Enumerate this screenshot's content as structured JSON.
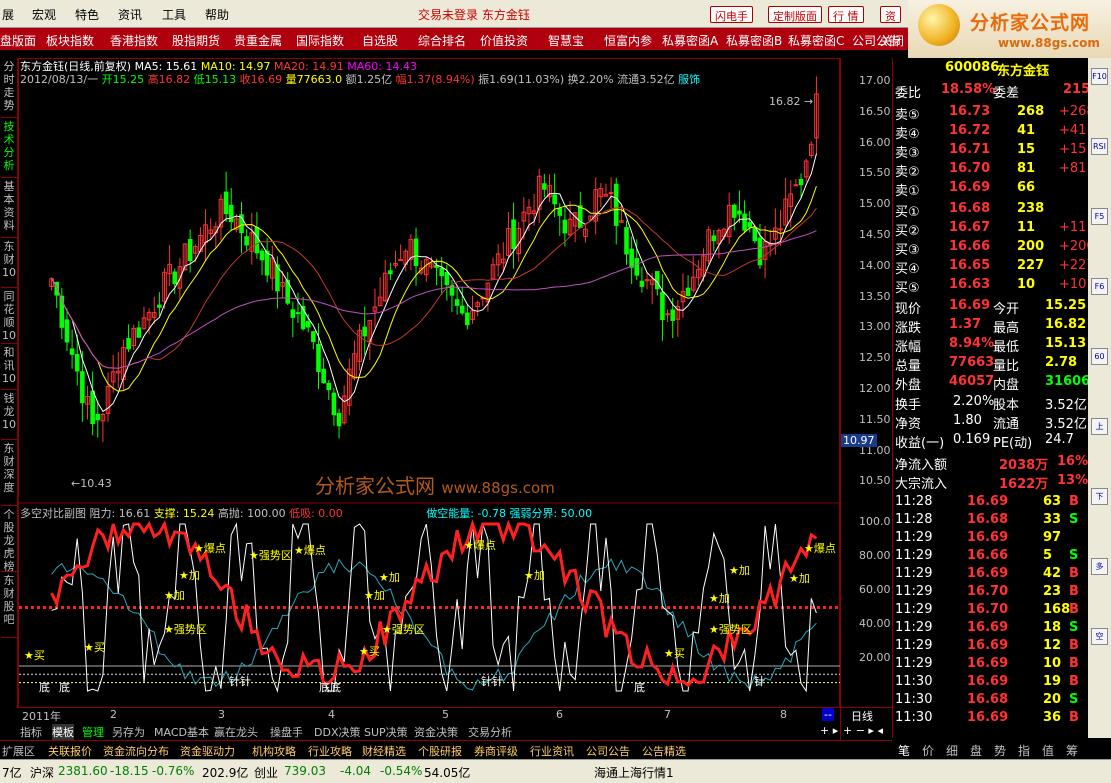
{
  "menu": {
    "items": [
      "展",
      "宏观",
      "特色",
      "资讯",
      "工具",
      "帮助"
    ],
    "trade_status": "交易未登录  东方金钰",
    "buttons": [
      "闪电手",
      "定制版面",
      "行 情",
      "资"
    ]
  },
  "logo": {
    "title": "分析家公式网",
    "url": "www.88gs.com"
  },
  "nav": {
    "items": [
      "盘版面",
      "板块指数",
      "香港指数",
      "股指期货",
      "贵重金属",
      "国际指数",
      "自选股",
      "综合排名",
      "价值投资",
      "智慧宝",
      "恒富内参",
      "私募密函A",
      "私募密函B",
      "私募密函C",
      "公司公告",
      "关闭"
    ]
  },
  "left_tabs": [
    "分时走势",
    "技术分析",
    "基本资料",
    "东财10",
    "同花顺10",
    "和讯10",
    "钱龙10",
    "东财深度",
    "个股龙虎榜",
    "东财股吧"
  ],
  "chart_header": {
    "title": "东方金钰(日线,前复权)",
    "ma5": "MA5: 15.61",
    "ma10": "MA10: 14.97",
    "ma20": "MA20: 14.91",
    "ma60": "MA60: 14.43",
    "date": "2012/08/13/一",
    "open": "开15.25",
    "high": "高16.82",
    "low": "低15.13",
    "close": "收16.69",
    "vol": "量77663.0",
    "amt": "额1.25亿",
    "range": "幅1.37(8.94%)",
    "amp": "振1.69(11.03%)",
    "turn": "换2.20%",
    "float": "流通3.52亿",
    "fuse": "服饰"
  },
  "annotations": {
    "hi": "16.82",
    "lo": "10.43",
    "cursor": "10.97"
  },
  "watermark": {
    "cn": "分析家公式网",
    "url": "www.88gs.com"
  },
  "sub_header": {
    "title": "多空对比副图",
    "resist": "阻力: 16.61",
    "support": "支撑: 15.24",
    "highsell": "高抛: 100.00",
    "lowbuy": "低吸: 0.00",
    "energy": "做空能量: -0.78",
    "boundary": "强弱分界: 50.00"
  },
  "sub_labels": [
    "★加",
    "★加",
    "★加",
    "★加",
    "★加",
    "★加",
    "★加",
    "★加",
    "★爆点",
    "★爆点",
    "★爆点",
    "★爆点",
    "★强势区",
    "★强势区",
    "★强势区",
    "★强势区",
    "★买",
    "★买",
    "★买",
    "★买",
    "底",
    "底",
    "针针",
    "底底",
    "针针",
    "底",
    "针"
  ],
  "price_ticks": [
    "17.00",
    "16.50",
    "16.00",
    "15.50",
    "15.00",
    "14.50",
    "14.00",
    "13.50",
    "13.00",
    "12.50",
    "12.00",
    "11.50",
    "11.00",
    "10.50"
  ],
  "sub_ticks": [
    "100.0",
    "80.00",
    "60.00",
    "40.00",
    "20.00"
  ],
  "time_axis": [
    "2011年",
    "2",
    "3",
    "4",
    "5",
    "6",
    "7",
    "8"
  ],
  "bottom_tabs": [
    "指标",
    "模板",
    "管理",
    "另存为",
    "MACD基本",
    "赢在龙头",
    "操盘手",
    "DDX决策",
    "SUP决策",
    "资金决策",
    "交易分析"
  ],
  "period": "日线",
  "bottom_tabs2": [
    "扩展区",
    "关联报价",
    "资金流向分布",
    "资金驱动力",
    "机构攻略",
    "行业攻略",
    "财经精选",
    "个股研报",
    "券商评级",
    "行业资讯",
    "公司公告",
    "公告精选"
  ],
  "quote": {
    "code": "600086",
    "name": "东方金钰",
    "webi": {
      "label": "委比",
      "value": "18.58%",
      "label2": "委差",
      "value2": "215"
    },
    "sell": [
      {
        "l": "卖⑤",
        "p": "16.73",
        "v": "268",
        "d": "+268"
      },
      {
        "l": "卖④",
        "p": "16.72",
        "v": "41",
        "d": "+41"
      },
      {
        "l": "卖③",
        "p": "16.71",
        "v": "15",
        "d": "+15"
      },
      {
        "l": "卖②",
        "p": "16.70",
        "v": "81",
        "d": "+81"
      },
      {
        "l": "卖①",
        "p": "16.69",
        "v": "66",
        "d": ""
      }
    ],
    "buy": [
      {
        "l": "买①",
        "p": "16.68",
        "v": "238",
        "d": ""
      },
      {
        "l": "买②",
        "p": "16.67",
        "v": "11",
        "d": "+11"
      },
      {
        "l": "买③",
        "p": "16.66",
        "v": "200",
        "d": "+200"
      },
      {
        "l": "买④",
        "p": "16.65",
        "v": "227",
        "d": "+227"
      },
      {
        "l": "买⑤",
        "p": "16.63",
        "v": "10",
        "d": "+10"
      }
    ],
    "stats": [
      {
        "l": "现价",
        "v": "16.69",
        "l2": "今开",
        "v2": "15.25"
      },
      {
        "l": "涨跌",
        "v": "1.37",
        "l2": "最高",
        "v2": "16.82"
      },
      {
        "l": "涨幅",
        "v": "8.94%",
        "l2": "最低",
        "v2": "15.13"
      },
      {
        "l": "总量",
        "v": "77663",
        "l2": "量比",
        "v2": "2.78"
      },
      {
        "l": "外盘",
        "v": "46057",
        "l2": "内盘",
        "v2": "31606"
      }
    ],
    "fin": [
      {
        "l": "换手",
        "v": "2.20%",
        "l2": "股本",
        "v2": "3.52亿"
      },
      {
        "l": "净资",
        "v": "1.80",
        "l2": "流通",
        "v2": "3.52亿"
      },
      {
        "l": "收益(一)",
        "v": "0.169",
        "l2": "PE(动)",
        "v2": "24.7"
      }
    ],
    "flow": [
      {
        "l": "净流入额",
        "v": "2038万",
        "p": "16%"
      },
      {
        "l": "大宗流入",
        "v": "1622万",
        "p": "13%"
      }
    ],
    "ticks": [
      {
        "t": "11:28",
        "p": "16.69",
        "v": "63",
        "s": "B"
      },
      {
        "t": "11:28",
        "p": "16.68",
        "v": "33",
        "s": "S"
      },
      {
        "t": "11:29",
        "p": "16.69",
        "v": "97",
        "s": ""
      },
      {
        "t": "11:29",
        "p": "16.66",
        "v": "5",
        "s": "S"
      },
      {
        "t": "11:29",
        "p": "16.69",
        "v": "42",
        "s": "B"
      },
      {
        "t": "11:29",
        "p": "16.70",
        "v": "23",
        "s": "B"
      },
      {
        "t": "11:29",
        "p": "16.70",
        "v": "168",
        "s": "B"
      },
      {
        "t": "11:29",
        "p": "16.69",
        "v": "18",
        "s": "S"
      },
      {
        "t": "11:29",
        "p": "16.69",
        "v": "12",
        "s": "B"
      },
      {
        "t": "11:29",
        "p": "16.69",
        "v": "10",
        "s": "B"
      },
      {
        "t": "11:30",
        "p": "16.69",
        "v": "19",
        "s": "B"
      },
      {
        "t": "11:30",
        "p": "16.68",
        "v": "20",
        "s": "S"
      },
      {
        "t": "11:30",
        "p": "16.69",
        "v": "36",
        "s": "B"
      }
    ]
  },
  "quote_tabs": [
    "笔",
    "价",
    "细",
    "盘",
    "势",
    "指",
    "值",
    "筹"
  ],
  "status": {
    "sh_name": "沪深",
    "sh_idx": "2381.60",
    "sh_chg": "-18.15",
    "sh_pct": "-0.76%",
    "sh_amt": "202.9亿",
    "cy_name": "创业",
    "cy_idx": "739.03",
    "cy_chg": "-4.04",
    "cy_pct": "-0.54%",
    "cy_amt": "54.05亿",
    "feed": "海通上海行情1",
    "prefix": "7亿"
  },
  "right_icons": [
    "F10",
    "RSI",
    "F5",
    "F6",
    "60",
    "上",
    "下",
    "多",
    "空"
  ],
  "colors": {
    "up": "#ff3333",
    "down": "#00ff00",
    "ma5": "#ffffff",
    "ma10": "#ffff00",
    "ma20": "#c0392b",
    "ma60": "#c050c0",
    "accent": "#b0000d"
  }
}
